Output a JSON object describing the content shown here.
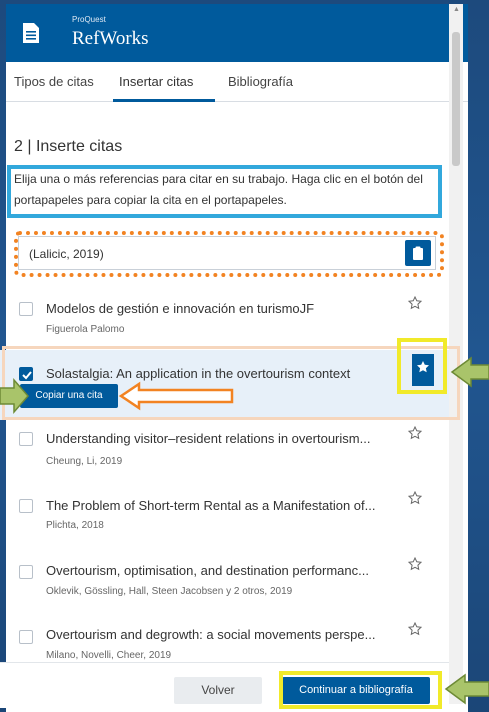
{
  "header": {
    "brand_small": "ProQuest",
    "brand": "RefWorks"
  },
  "tabs": [
    {
      "label": "Tipos de citas"
    },
    {
      "label": "Insertar citas"
    },
    {
      "label": "Bibliografía"
    }
  ],
  "step_title": "2 | Inserte citas",
  "instructions": "Elija una o más referencias para citar en su trabajo. Haga clic en el botón del portapapeles para copiar la cita en el portapapeles.",
  "citation_preview": "(Lalicic, 2019)",
  "references": [
    {
      "title": "Modelos de gestión e innovación en turismoJF",
      "authors": "Figuerola Palomo",
      "checked": false
    },
    {
      "title": "Solastalgia: An application in the overtourism context",
      "authors": "",
      "checked": true
    },
    {
      "title": "Understanding visitor–resident relations in overtourism...",
      "authors": "Cheung, Li, 2019",
      "checked": false
    },
    {
      "title": "The Problem of Short-term Rental as a Manifestation of...",
      "authors": "Plichta, 2018",
      "checked": false
    },
    {
      "title": "Overtourism, optimisation, and destination performanc...",
      "authors": "Oklevik, Gössling, Hall, Steen Jacobsen y 2 otros, 2019",
      "checked": false
    },
    {
      "title": "Overtourism and degrowth: a social movements perspe...",
      "authors": "Milano, Novelli, Cheer, 2019",
      "checked": false
    }
  ],
  "copy_button": "Copiar una cita",
  "footer": {
    "back": "Volver",
    "continue": "Continuar a bibliografía"
  },
  "colors": {
    "primary": "#005a9c",
    "annotation_blue": "#32a8dc",
    "annotation_orange": "#f28322",
    "annotation_yellow": "#f1ea2a",
    "annotation_green": "#a9c46a"
  },
  "icons": {
    "header": "document-icon",
    "clipboard": "clipboard-icon",
    "star": "star-outline-icon",
    "star_selected": "bookmark-star-icon"
  }
}
